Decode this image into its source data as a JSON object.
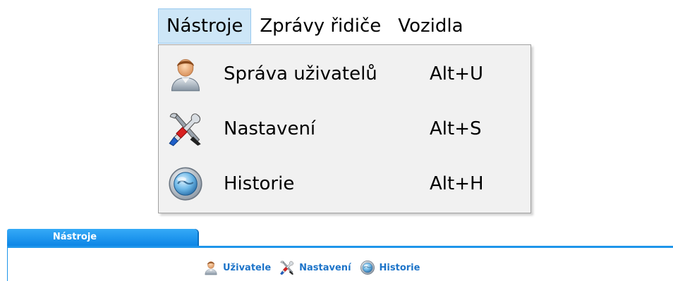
{
  "menubar": {
    "items": [
      {
        "label": "Nástroje",
        "active": true
      },
      {
        "label": "Zprávy řidiče",
        "active": false
      },
      {
        "label": "Vozidla",
        "active": false
      }
    ]
  },
  "dropdown": {
    "items": [
      {
        "label": "Správa uživatelů",
        "shortcut": "Alt+U",
        "icon": "user-icon"
      },
      {
        "label": "Nastavení",
        "shortcut": "Alt+S",
        "icon": "tools-icon"
      },
      {
        "label": "Historie",
        "shortcut": "Alt+H",
        "icon": "history-icon"
      }
    ]
  },
  "tab": {
    "label": "Nástroje",
    "accent": "#1e95ea"
  },
  "toolbar": {
    "items": [
      {
        "label": "Uživatele",
        "icon": "user-icon"
      },
      {
        "label": "Nastavení",
        "icon": "tools-icon"
      },
      {
        "label": "Historie",
        "icon": "history-icon"
      }
    ],
    "label_color": "#1d74c9"
  }
}
